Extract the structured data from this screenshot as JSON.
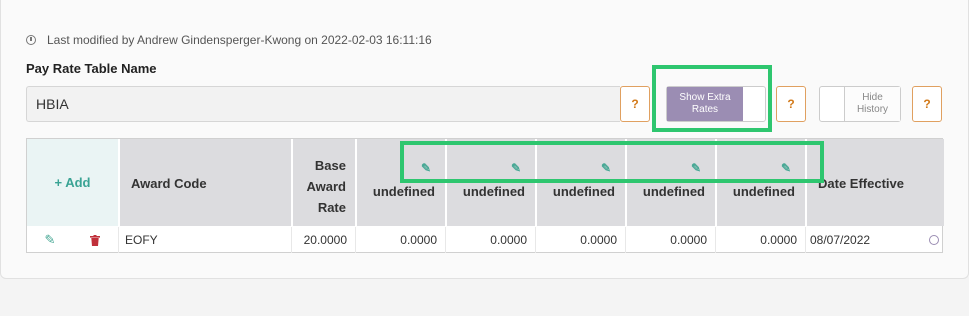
{
  "meta": {
    "last_modified": "Last modified by Andrew Gindensperger-Kwong on 2022-02-03 16:11:16"
  },
  "form": {
    "label": "Pay Rate Table Name",
    "value": "HBIA"
  },
  "buttons": {
    "help": "?",
    "show_extra_rates_line1": "Show Extra",
    "show_extra_rates_line2": "Rates",
    "hide_history_line1": "Hide",
    "hide_history_line2": "History"
  },
  "table": {
    "add_label": "+ Add",
    "headers": {
      "award_code": "Award Code",
      "base_line1": "Base",
      "base_line2": "Award",
      "base_line3": "Rate",
      "extra": [
        "undefined",
        "undefined",
        "undefined",
        "undefined",
        "undefined"
      ],
      "date_effective": "Date Effective"
    },
    "rows": [
      {
        "award_code": "EOFY",
        "base_rate": "20.0000",
        "extras": [
          "0.0000",
          "0.0000",
          "0.0000",
          "0.0000",
          "0.0000"
        ],
        "date_effective": "08/07/2022"
      }
    ]
  },
  "colors": {
    "accent_green": "#2ec66f",
    "teal": "#3aa394",
    "orange": "#d27a1a",
    "purple": "#9b8db3",
    "delete_red": "#c0303a"
  }
}
